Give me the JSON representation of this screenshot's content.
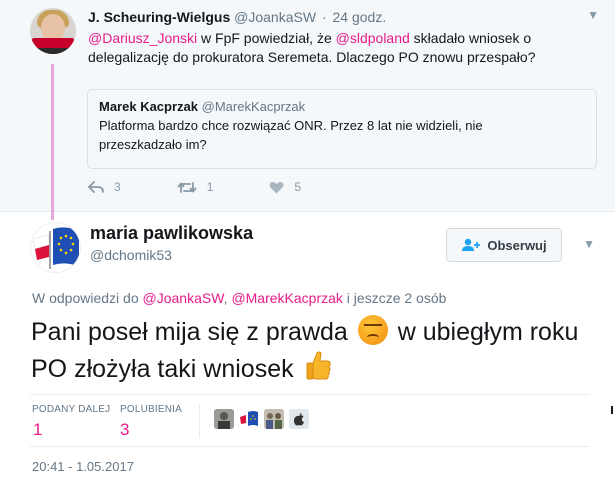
{
  "parent_tweet": {
    "name": "J. Scheuring-Wielgus",
    "handle": "@JoankaSW",
    "separator": "·",
    "time": "24 godz.",
    "text_parts": [
      {
        "text": "@Dariusz_Jonski",
        "mention": true
      },
      {
        "text": " w FpF powiedział, że ",
        "mention": false
      },
      {
        "text": "@sldpoland",
        "mention": true
      },
      {
        "text": " składało wniosek o delegalizację do prokuratora Seremeta. Dlaczego PO znowu przespało?",
        "mention": false
      }
    ],
    "quote": {
      "name": "Marek Kacprzak",
      "handle": "@MarekKacprzak",
      "text": "Platforma bardzo chce rozwiązać ONR. Przez 8 lat nie widzieli,  nie przeszkadzało im?"
    },
    "actions": {
      "reply_count": "3",
      "retweet_count": "1",
      "like_count": "5"
    }
  },
  "main_tweet": {
    "name": "maria pawlikowska",
    "handle": "@dchomik53",
    "follow_label": "Obserwuj",
    "reply_to": {
      "prefix": "W odpowiedzi do ",
      "mention1": "@JoankaSW",
      "comma": ", ",
      "mention2": "@MarekKacprzak",
      "suffix": " i jeszcze 2 osób"
    },
    "text_part1": "Pani poseł mija się z prawda ",
    "text_part2": " w ubiegłym roku PO złożyła taki wniosek ",
    "emoji1": "angry-face",
    "emoji2": "thumbs-up",
    "stats": {
      "retweets_label": "PODANY DALEJ",
      "retweets_value": "1",
      "likes_label": "POLUBIENIA",
      "likes_value": "3"
    },
    "timestamp": "20:41 - 1.05.2017"
  },
  "colors": {
    "accent": "#e81c8b",
    "thread_line": "#e6a7dc",
    "muted": "#657786"
  }
}
